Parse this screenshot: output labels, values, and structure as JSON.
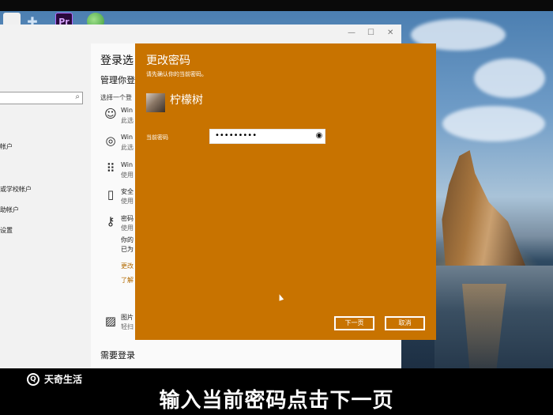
{
  "settings_window": {
    "title": "登录选",
    "subtitle": "管理你登",
    "choose_text": "选择一个登",
    "left_items": [
      "帐户",
      "或学校帐户",
      "助帐户",
      "设置"
    ],
    "options": [
      {
        "icon": "smile-icon",
        "glyph": "☺",
        "line1": "Win",
        "line2": "此选"
      },
      {
        "icon": "fingerprint-icon",
        "glyph": "◎",
        "line1": "Win",
        "line2": "此选"
      },
      {
        "icon": "pin-grid-icon",
        "glyph": "⠿",
        "line1": "Win",
        "line2": "使用"
      },
      {
        "icon": "security-key-icon",
        "glyph": "▯",
        "line1": "安全",
        "line2": "使用"
      },
      {
        "icon": "key-icon",
        "glyph": "⚷",
        "line1": "密码",
        "line2": "使用"
      }
    ],
    "password_detail": [
      "你的",
      "已为"
    ],
    "links": [
      "更改",
      "了解"
    ],
    "picture_option": {
      "line1": "图片",
      "line2": "轻扫"
    },
    "need_login": "需要登录"
  },
  "dialog": {
    "title": "更改密码",
    "subtitle": "请先确认你的当前密码。",
    "username": "柠檬树",
    "field_label": "当前密码",
    "password_value": "•••••••••",
    "next_button": "下一页",
    "cancel_button": "取消"
  },
  "caption": {
    "brand": "天奇生活",
    "logo_letter": "Q",
    "subtitle": "输入当前密码点击下一页"
  },
  "taskbar": {
    "pr_label": "Pr"
  }
}
